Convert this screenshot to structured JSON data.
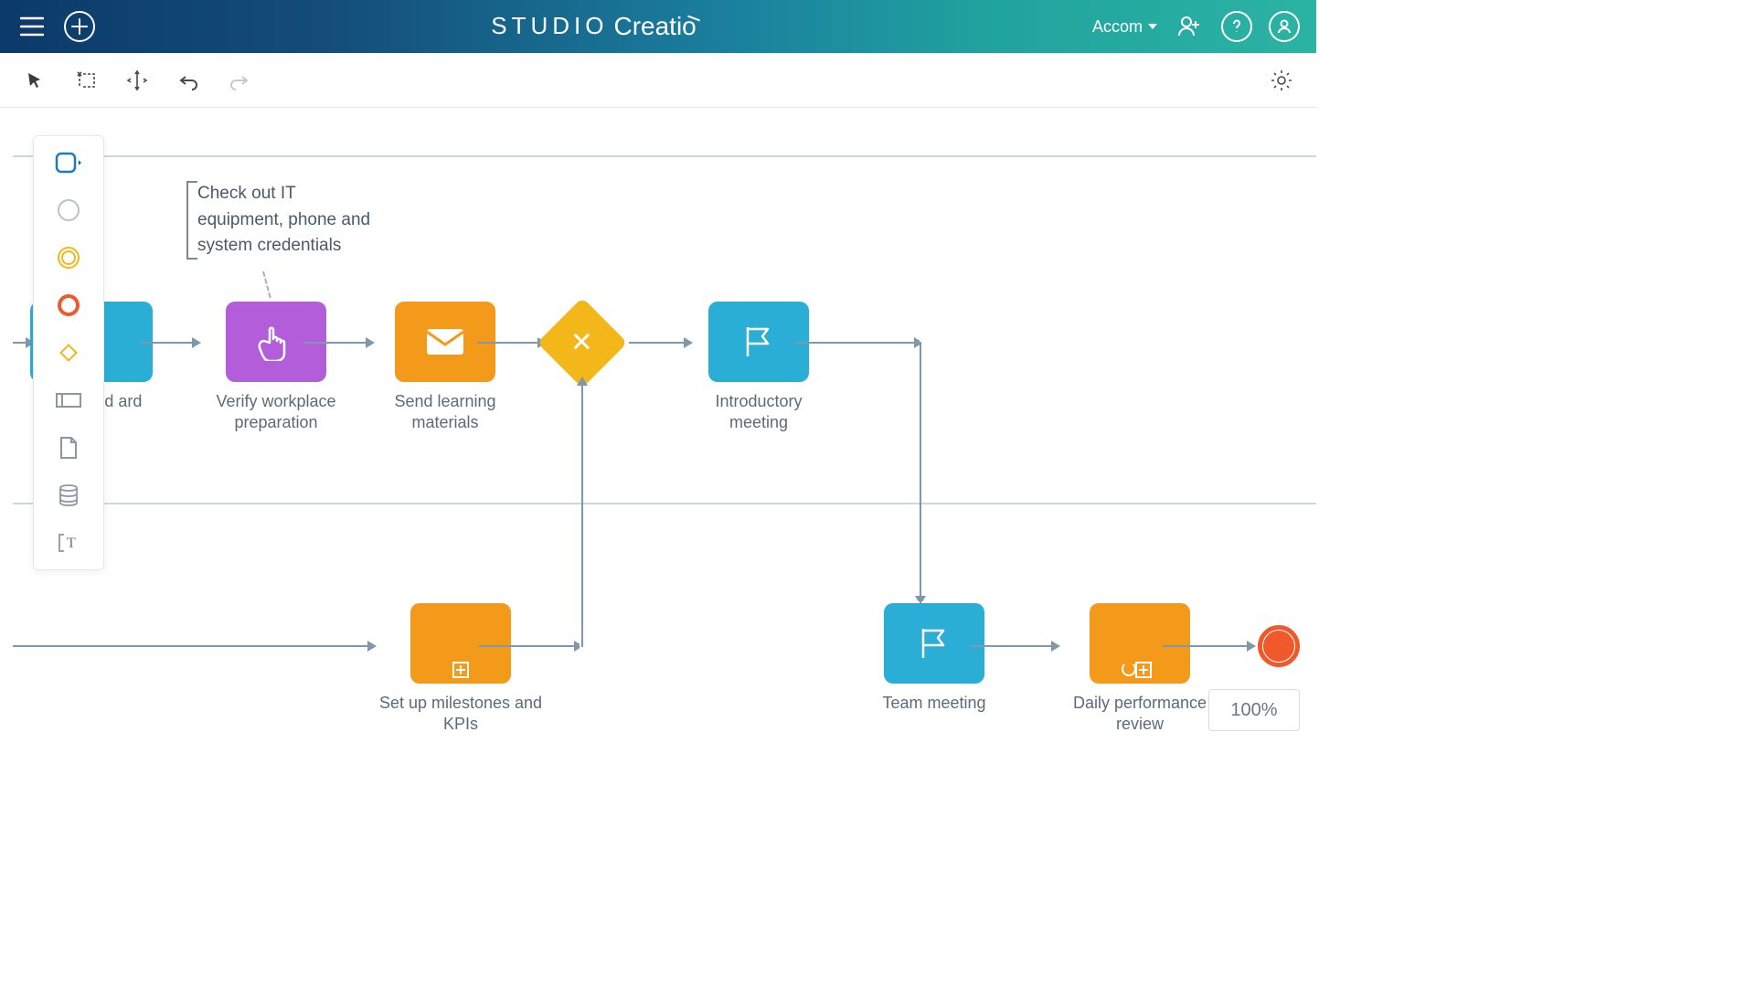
{
  "header": {
    "logo_studio": "STUDIO",
    "logo_brand": "Creatio",
    "workspace_dropdown": "Accom"
  },
  "annotation": {
    "text": "Check out IT equipment, phone and system credentials"
  },
  "nodes": {
    "keys_card": {
      "label": "P        eys and          ard"
    },
    "verify_workplace": {
      "label": "Verify workplace preparation"
    },
    "send_learning": {
      "label": "Send learning materials"
    },
    "intro_meeting": {
      "label": "Introductory meeting"
    },
    "milestones": {
      "label": "Set up milestones and KPIs"
    },
    "team_meeting": {
      "label": "Team meeting"
    },
    "daily_review": {
      "label": "Daily performance review"
    }
  },
  "zoom": {
    "level": "100%"
  },
  "colors": {
    "cyan": "#2aaed6",
    "purple": "#b45ddb",
    "orange": "#f49a1a",
    "gateway": "#f4b71a",
    "end_event": "#f0592b"
  }
}
